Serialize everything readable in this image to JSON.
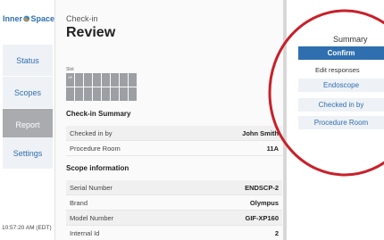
{
  "sidebar": {
    "logo_part1": "Inner",
    "logo_part2": "Space",
    "items": [
      {
        "label": "Status"
      },
      {
        "label": "Scopes"
      },
      {
        "label": "Report"
      },
      {
        "label": "Settings"
      }
    ],
    "clock": "10:57:20 AM (EDT)"
  },
  "main": {
    "eyebrow": "Check-in",
    "title": "Review",
    "slot_label": "Slot",
    "slots": [
      "28",
      "",
      "",
      "",
      "",
      "",
      "",
      "",
      "",
      "",
      "",
      "",
      "",
      "",
      "",
      ""
    ],
    "checkin_summary": {
      "heading": "Check-in Summary",
      "rows": [
        {
          "key": "Checked in by",
          "value": "John Smith"
        },
        {
          "key": "Procedure Room",
          "value": "11A"
        }
      ]
    },
    "scope_info": {
      "heading": "Scope information",
      "rows": [
        {
          "key": "Serial Number",
          "value": "ENDSCP-2"
        },
        {
          "key": "Brand",
          "value": "Olympus"
        },
        {
          "key": "Model Number",
          "value": "GIF-XP160"
        },
        {
          "key": "Internal Id",
          "value": "2"
        }
      ]
    }
  },
  "summary": {
    "title": "Summary",
    "confirm_label": "Confirm",
    "edit_label": "Edit responses",
    "edit_buttons": [
      "Endoscope",
      "Checked in by",
      "Procedure Room"
    ]
  },
  "colors": {
    "accent": "#2f6fb0",
    "annotation": "#c8202a",
    "active_nav": "#a9abae"
  }
}
